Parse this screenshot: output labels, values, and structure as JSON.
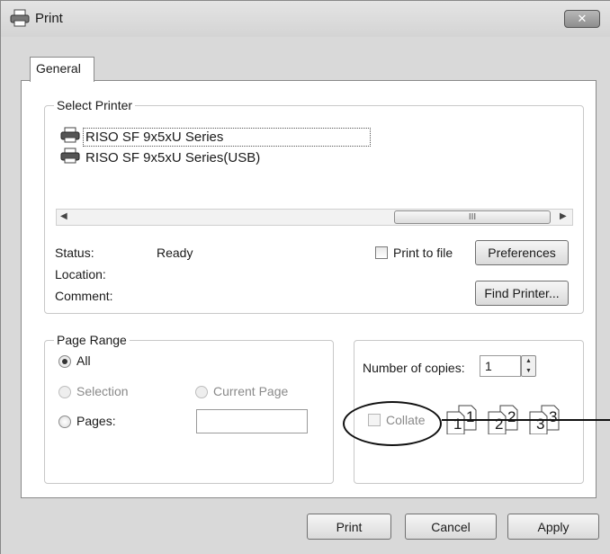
{
  "window": {
    "title": "Print",
    "close_glyph": "✕"
  },
  "tabs": [
    {
      "label": "General"
    }
  ],
  "select_printer": {
    "legend": "Select Printer",
    "printers": [
      {
        "name": "RISO SF 9x5xU Series",
        "selected": true
      },
      {
        "name": "RISO SF 9x5xU Series(USB)",
        "selected": false
      }
    ],
    "scroll_grip": "III"
  },
  "status": {
    "status_label": "Status:",
    "status_value": "Ready",
    "location_label": "Location:",
    "comment_label": "Comment:",
    "print_to_file_label": "Print to file",
    "print_to_file_checked": false,
    "preferences_label": "Preferences",
    "find_printer_label": "Find Printer..."
  },
  "page_range": {
    "legend": "Page Range",
    "all_label": "All",
    "selection_label": "Selection",
    "current_page_label": "Current Page",
    "pages_label": "Pages:",
    "selected_option": "All",
    "pages_value": ""
  },
  "copies": {
    "label": "Number of copies:",
    "value": "1",
    "collate_label": "Collate",
    "collate_checked": false,
    "collate_pages": [
      "1",
      "1",
      "2",
      "2",
      "3",
      "3"
    ]
  },
  "footer": {
    "print_label": "Print",
    "cancel_label": "Cancel",
    "apply_label": "Apply"
  },
  "icons": {
    "window": "printer-icon",
    "printer": "printer-icon",
    "close": "close-icon"
  }
}
